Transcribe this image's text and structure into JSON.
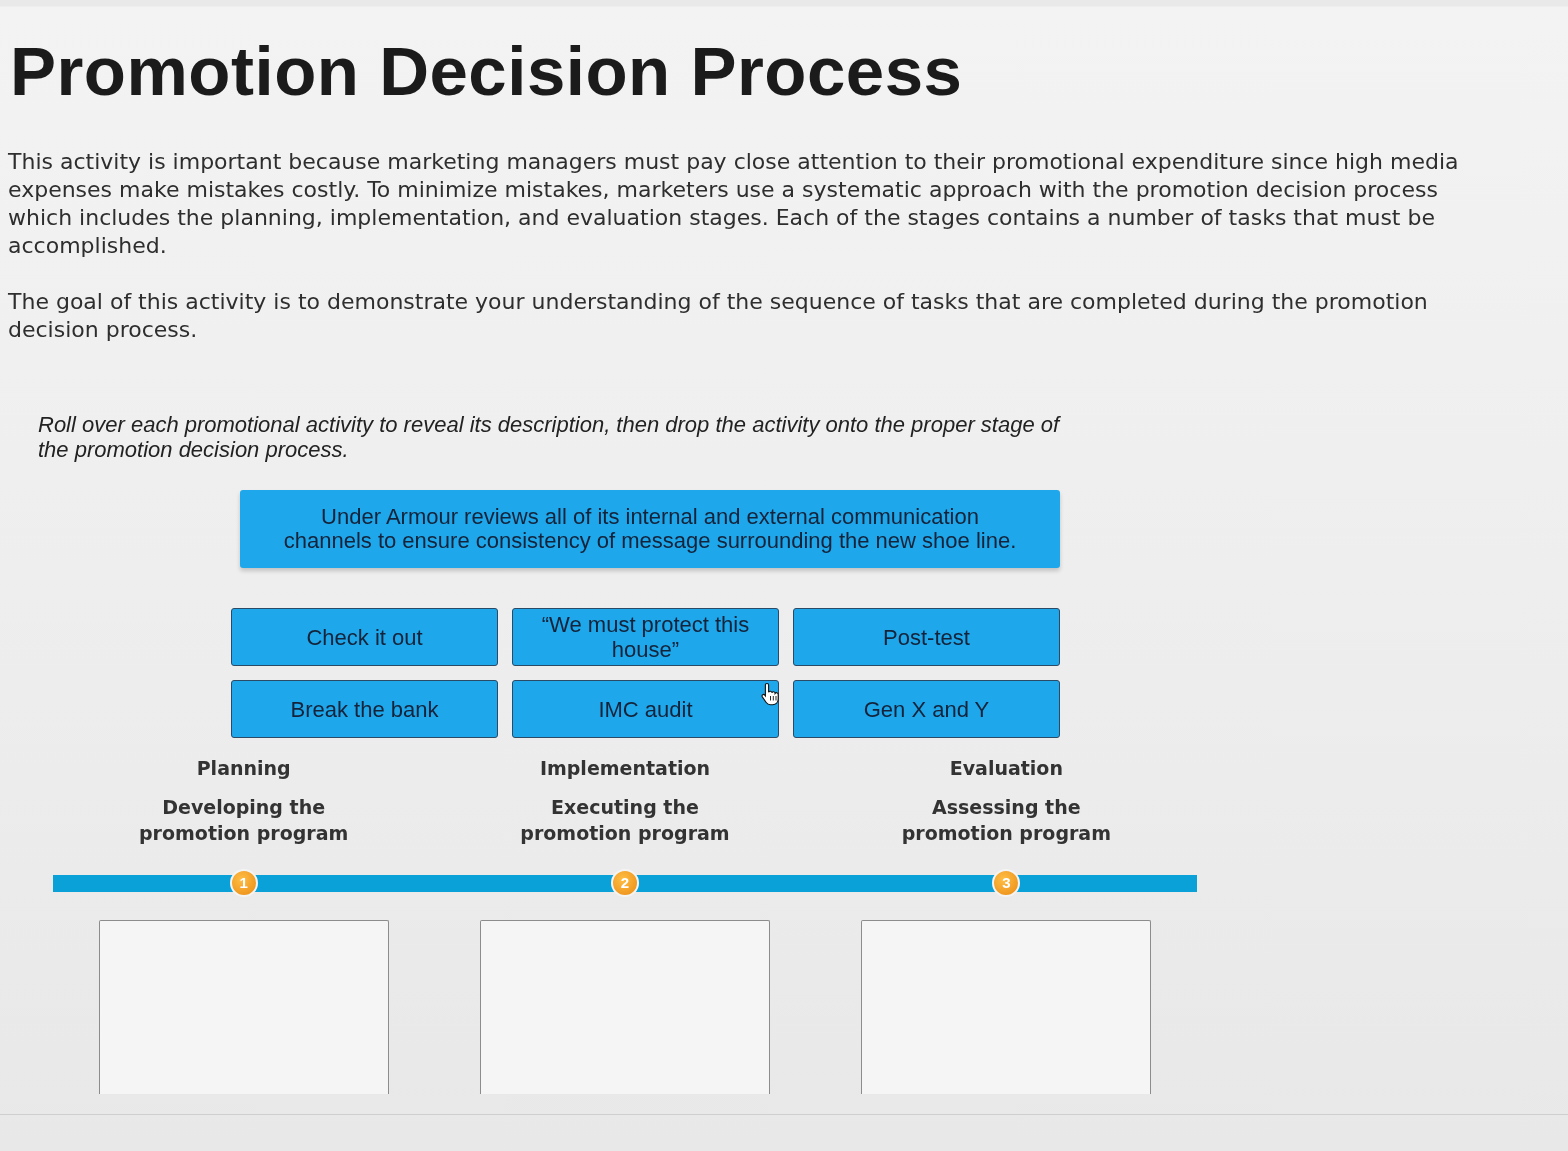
{
  "title": "Promotion Decision Process",
  "intro": [
    "This activity is important because marketing managers must pay close attention to their promotional expenditure since high media expenses make mistakes costly. To minimize mistakes, marketers use a systematic approach with the promotion decision process which includes the planning, implementation, and evaluation stages. Each of the stages contains a number of tasks that must be accomplished.",
    "The goal of this activity is to demonstrate your understanding of the sequence of tasks that are completed during the promotion decision process."
  ],
  "instruction": "Roll over each promotional activity to reveal its description, then drop the activity onto the proper stage of the promotion decision process.",
  "description_card": "Under Armour reviews all of its internal and external communication channels to ensure consistency of message surrounding the new shoe line.",
  "activities": [
    "Check it out",
    "“We must protect this house”",
    "Post-test",
    "Break the bank",
    "IMC audit",
    "Gen X and Y"
  ],
  "stages": [
    {
      "number": "1",
      "name": "Planning",
      "description": "Developing the promotion program"
    },
    {
      "number": "2",
      "name": "Implementation",
      "description": "Executing the promotion program"
    },
    {
      "number": "3",
      "name": "Evaluation",
      "description": "Assessing the promotion program"
    }
  ]
}
